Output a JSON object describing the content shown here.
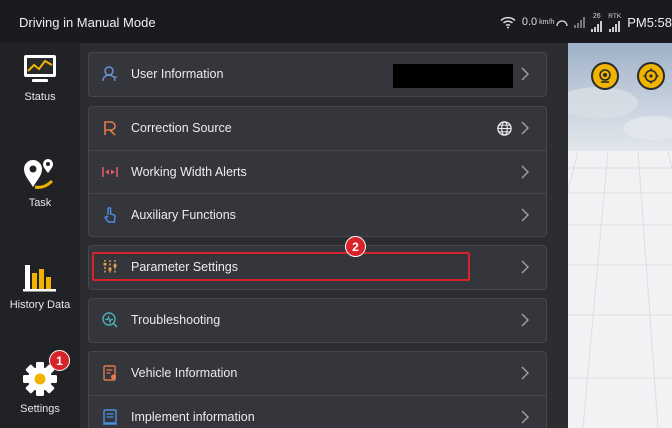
{
  "status_bar": {
    "title": "Driving in Manual Mode",
    "speed_value": "0.0",
    "speed_unit": "km/h",
    "satellite_count": "26",
    "rtk_label": "RTK",
    "time": "PM5:58"
  },
  "sidebar": {
    "items": [
      {
        "label": "Status"
      },
      {
        "label": "Task"
      },
      {
        "label": "History Data"
      },
      {
        "label": "Settings"
      }
    ]
  },
  "settings": {
    "user_info": "User Information",
    "correction_source": "Correction Source",
    "working_width_alerts": "Working Width Alerts",
    "auxiliary_functions": "Auxiliary Functions",
    "parameter_settings": "Parameter Settings",
    "troubleshooting": "Troubleshooting",
    "vehicle_information": "Vehicle Information",
    "implement_information": "Implement information"
  },
  "annotations": {
    "badge_1": "1",
    "badge_2": "2"
  },
  "colors": {
    "accent_orange": "#f0b400",
    "annotation_red": "#d8232a"
  }
}
